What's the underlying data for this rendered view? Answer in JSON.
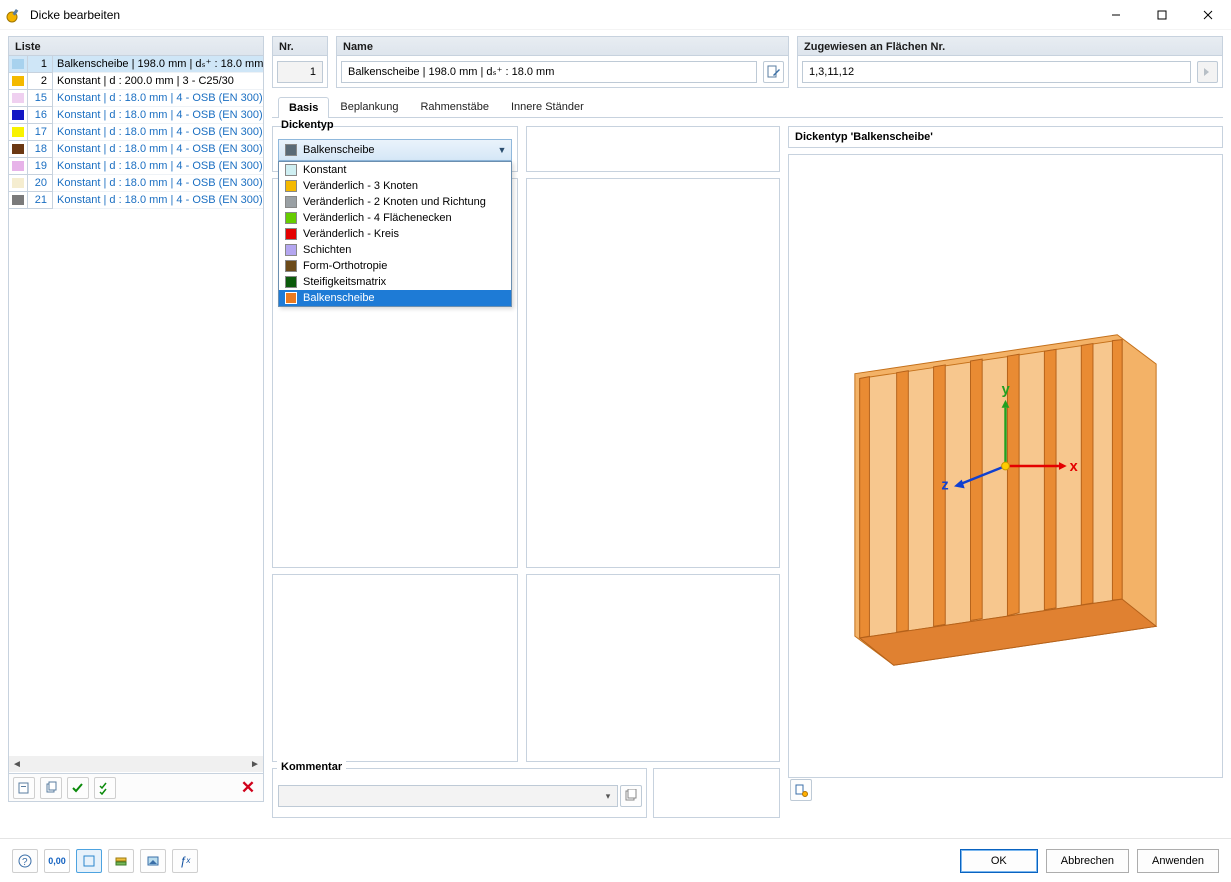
{
  "window": {
    "title": "Dicke bearbeiten"
  },
  "liste": {
    "header": "Liste",
    "items": [
      {
        "n": 1,
        "text": "Balkenscheibe | 198.0 mm | dₛ⁺ : 18.0 mm",
        "color": "#a8d2ee",
        "selected": true,
        "black": true
      },
      {
        "n": 2,
        "text": "Konstant | d : 200.0 mm | 3 - C25/30",
        "color": "#f4b900",
        "black": true
      },
      {
        "n": 15,
        "text": "Konstant | d : 18.0 mm | 4 - OSB (EN 300),",
        "color": "#efd0f0"
      },
      {
        "n": 16,
        "text": "Konstant | d : 18.0 mm | 4 - OSB (EN 300),",
        "color": "#1216c4"
      },
      {
        "n": 17,
        "text": "Konstant | d : 18.0 mm | 4 - OSB (EN 300),",
        "color": "#f8f200"
      },
      {
        "n": 18,
        "text": "Konstant | d : 18.0 mm | 4 - OSB (EN 300),",
        "color": "#6b3813"
      },
      {
        "n": 19,
        "text": "Konstant | d : 18.0 mm | 4 - OSB (EN 300),",
        "color": "#e7b3e9"
      },
      {
        "n": 20,
        "text": "Konstant | d : 18.0 mm | 4 - OSB (EN 300),",
        "color": "#f5edd0"
      },
      {
        "n": 21,
        "text": "Konstant | d : 18.0 mm | 4 - OSB (EN 300),",
        "color": "#7a7a7a"
      }
    ]
  },
  "fields": {
    "nr_label": "Nr.",
    "nr_value": "1",
    "name_label": "Name",
    "name_value": "Balkenscheibe | 198.0 mm | dₛ⁺ : 18.0 mm",
    "assigned_label": "Zugewiesen an Flächen Nr.",
    "assigned_value": "1,3,11,12"
  },
  "tabs": [
    "Basis",
    "Beplankung",
    "Rahmenstäbe",
    "Innere Ständer"
  ],
  "active_tab": 0,
  "dickentyp": {
    "label": "Dickentyp",
    "selected": "Balkenscheibe",
    "selected_color": "#5a6a76",
    "options": [
      {
        "label": "Konstant",
        "color": "#cfeff2"
      },
      {
        "label": "Veränderlich - 3 Knoten",
        "color": "#f4b900"
      },
      {
        "label": "Veränderlich - 2 Knoten und Richtung",
        "color": "#9aa0a4"
      },
      {
        "label": "Veränderlich - 4 Flächenecken",
        "color": "#66cc00"
      },
      {
        "label": "Veränderlich - Kreis",
        "color": "#e40000"
      },
      {
        "label": "Schichten",
        "color": "#b4a6f0"
      },
      {
        "label": "Form-Orthotropie",
        "color": "#6b4a19"
      },
      {
        "label": "Steifigkeitsmatrix",
        "color": "#0b5a0b"
      },
      {
        "label": "Balkenscheibe",
        "color": "#ea7a1f",
        "hover": true
      }
    ]
  },
  "kommentar_label": "Kommentar",
  "preview": {
    "title": "Dickentyp  'Balkenscheibe'",
    "axes": {
      "x": "x",
      "y": "y",
      "z": "z"
    }
  },
  "buttons": {
    "ok": "OK",
    "cancel": "Abbrechen",
    "apply": "Anwenden"
  }
}
